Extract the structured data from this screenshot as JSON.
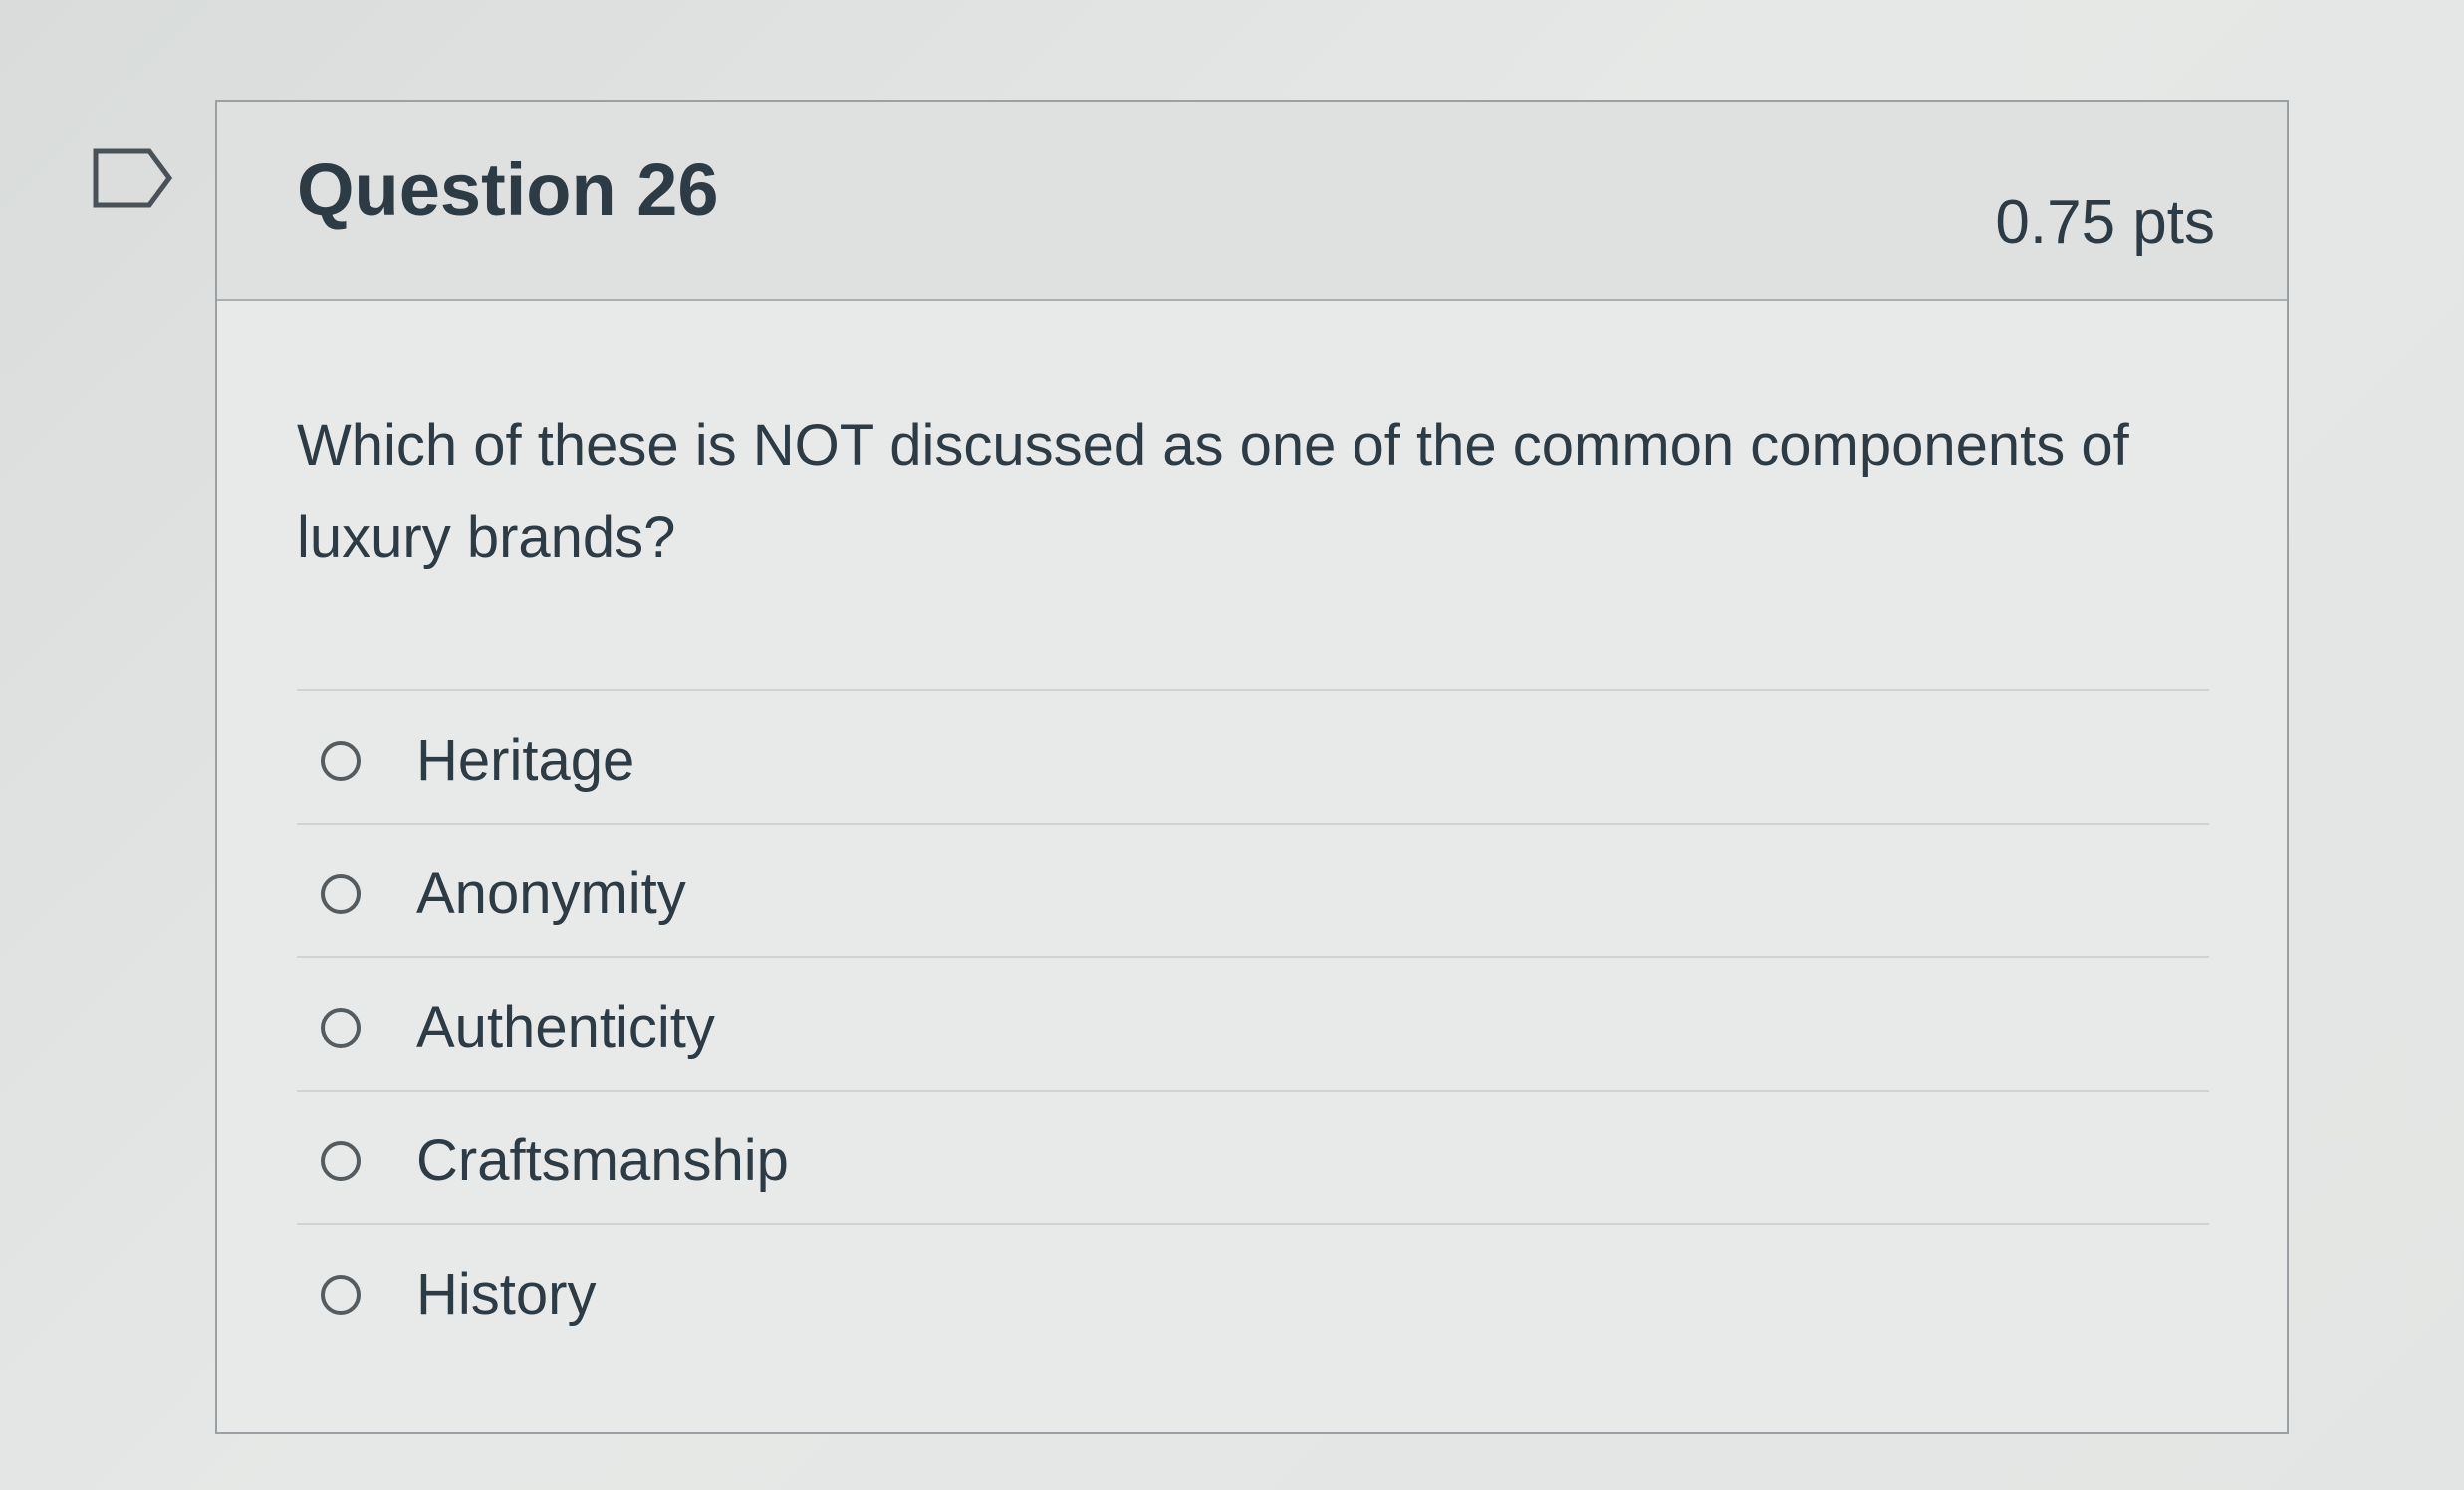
{
  "question": {
    "title": "Question 26",
    "points": "0.75 pts",
    "text": "Which of these is NOT discussed as one of the common components of luxury brands?"
  },
  "answers": [
    {
      "label": "Heritage",
      "selected": false
    },
    {
      "label": "Anonymity",
      "selected": false
    },
    {
      "label": "Authenticity",
      "selected": false
    },
    {
      "label": "Craftsmanship",
      "selected": false
    },
    {
      "label": "History",
      "selected": false
    }
  ],
  "icons": {
    "flag": "flag-question-icon"
  }
}
